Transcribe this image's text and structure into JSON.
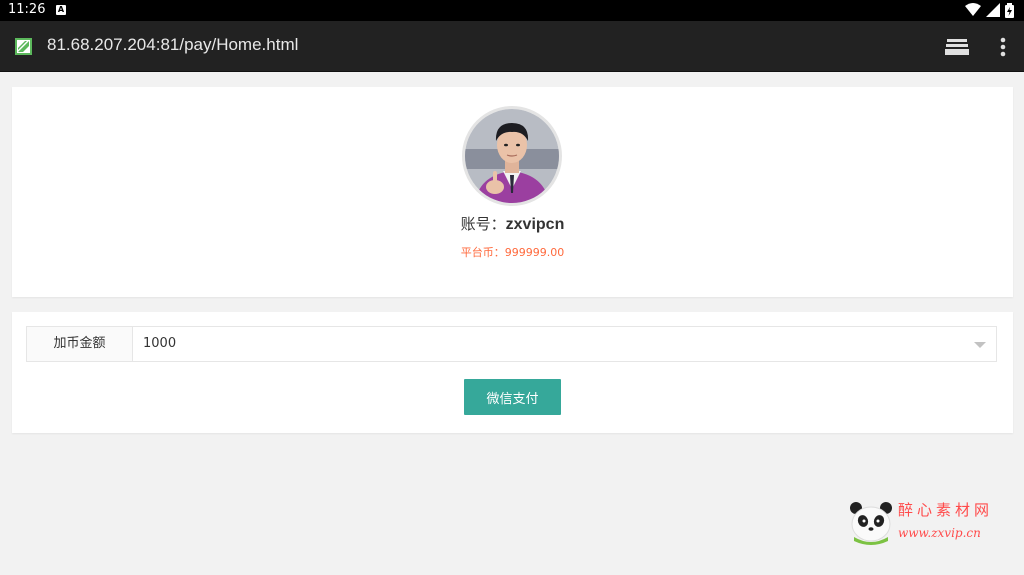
{
  "status_bar": {
    "time": "11:26",
    "notification_icon": "a-icon",
    "icons": [
      "wifi-icon",
      "signal-icon",
      "battery-icon"
    ]
  },
  "browser": {
    "url": "81.68.207.204:81/pay/Home.html",
    "site_icon": "site-favicon-icon",
    "tabs_icon": "tabs-icon",
    "menu_icon": "overflow-menu-icon"
  },
  "profile": {
    "account_label": "账号：",
    "account_value": "zxvipcn",
    "balance_label": "平台币：",
    "balance_value": "999999.00",
    "balance_color": "#ff6a3d"
  },
  "payment": {
    "amount_label": "加币金额",
    "amount_selected": "1000",
    "pay_button": "微信支付",
    "button_color": "#36a89a"
  },
  "watermark": {
    "brand_cn": "醉心素材网",
    "brand_url": "www.zxvip.cn"
  }
}
